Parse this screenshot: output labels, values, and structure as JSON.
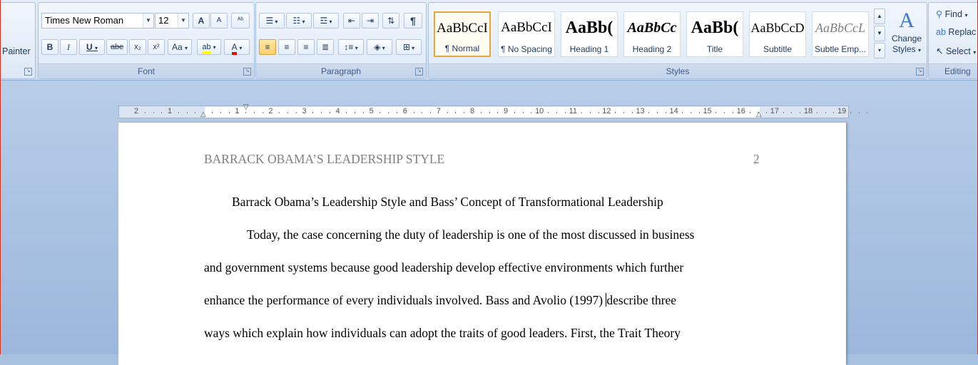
{
  "clipboard": {
    "format_painter_label": "Painter"
  },
  "font": {
    "group_label": "Font",
    "name": "Times New Roman",
    "size": "12",
    "grow_label": "A",
    "shrink_label": "A",
    "clear_label": "ᴬᵇ",
    "bold": "B",
    "italic": "I",
    "underline": "U",
    "strike": "abe",
    "subscript": "x₂",
    "superscript": "x²",
    "case": "Aa",
    "highlight": "ab",
    "color": "A"
  },
  "paragraph": {
    "group_label": "Paragraph",
    "pilcrow": "¶"
  },
  "styles": {
    "group_label": "Styles",
    "items": [
      {
        "sample": "AaBbCcI",
        "name": "¶ Normal"
      },
      {
        "sample": "AaBbCcI",
        "name": "¶ No Spacing"
      },
      {
        "sample": "AaBb(",
        "name": "Heading 1"
      },
      {
        "sample": "AaBbCc",
        "name": "Heading 2"
      },
      {
        "sample": "AaBb(",
        "name": "Title"
      },
      {
        "sample": "AaBbCcD",
        "name": "Subtitle"
      },
      {
        "sample": "AaBbCcL",
        "name": "Subtle Emp..."
      }
    ],
    "change_styles_line1": "Change",
    "change_styles_line2": "Styles"
  },
  "editing": {
    "group_label": "Editing",
    "find": "Find",
    "replace": "Replac",
    "select": "Select"
  },
  "ruler": {
    "labels": [
      "2",
      "1",
      "",
      "1",
      "2",
      "3",
      "4",
      "5",
      "6",
      "7",
      "8",
      "9",
      "10",
      "11",
      "12",
      "13",
      "14",
      "15",
      "16",
      "17",
      "18",
      "19"
    ]
  },
  "document": {
    "header_title": "BARRACK OBAMA’S LEADERSHIP STYLE",
    "page_number": "2",
    "title": "Barrack Obama’s Leadership Style and Bass’ Concept of Transformational Leadership",
    "line1": "Today, the case concerning the duty of leadership is one of the most discussed in business",
    "line2": "and government systems because good leadership develop effective environments which further",
    "line3a": "enhance the performance of every individuals involved. Bass and Avolio (1997) ",
    "line3b": "describe three",
    "line4": "ways which explain how individuals can adopt the traits of good leaders. First, the Trait Theory"
  },
  "colors": {
    "ribbon_bg": "#dbe6f5",
    "highlight": "#ffff00",
    "font_color": "#ff0000",
    "selected_style": "#e8a63a"
  }
}
